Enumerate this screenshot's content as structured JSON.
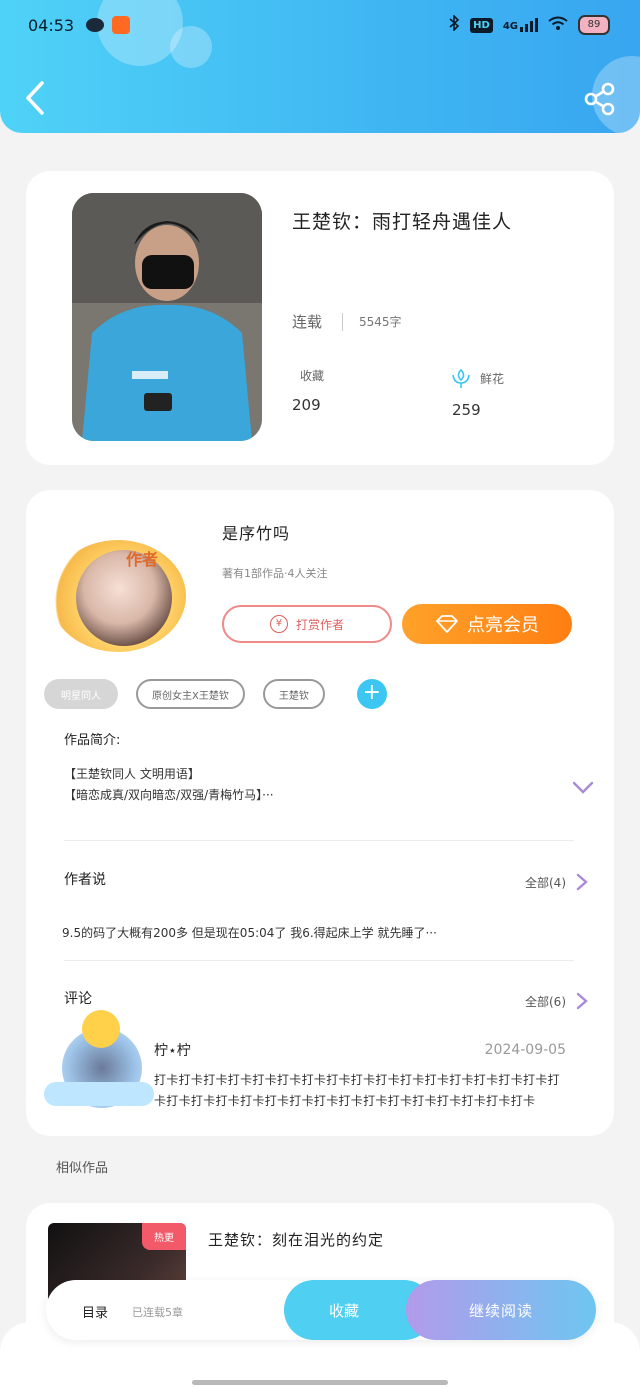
{
  "status_bar": {
    "time": "04:53",
    "network": "4G",
    "hd": "HD",
    "battery": "89"
  },
  "book": {
    "title": "王楚钦：雨打轻舟遇佳人",
    "status": "连载",
    "word_count": "5545字",
    "favorites_label": "收藏",
    "favorites_value": "209",
    "flowers_label": "鲜花",
    "flowers_value": "259"
  },
  "author": {
    "badge": "作者",
    "name": "是序竹吗",
    "meta": "著有1部作品·4人关注",
    "tip_label": "打赏作者",
    "vip_label": "点亮会员"
  },
  "tags": [
    "明星同人",
    "原创女主X王楚钦",
    "王楚钦"
  ],
  "intro": {
    "title": "作品简介:",
    "lines": [
      "【王楚钦同人 文明用语】",
      "【暗恋成真/双向暗恋/双强/青梅竹马】···"
    ]
  },
  "author_says": {
    "title": "作者说",
    "all_label": "全部(4)",
    "text": "9.5的码了大概有200多 但是现在05:04了 我6.得起床上学 就先睡了···"
  },
  "comments": {
    "title": "评论",
    "all_label": "全部(6)",
    "items": [
      {
        "user": "柠⋆柠",
        "date": "2024-09-05",
        "text": "打卡打卡打卡打卡打卡打卡打卡打卡打卡打卡打卡打卡打卡打卡打卡打卡打卡打卡打卡打卡打卡打卡打卡打卡打卡打卡打卡打卡打卡打卡打卡打卡"
      }
    ]
  },
  "similar": {
    "title": "相似作品",
    "items": [
      {
        "badge": "热更",
        "title": "王楚钦：刻在泪光的约定"
      }
    ]
  },
  "bottom_bar": {
    "toc_label": "目录",
    "chapters": "已连载5章",
    "favorite_label": "收藏",
    "read_label": "继续阅读"
  },
  "colors": {
    "header": "#3fb6f2",
    "vip": "#ff8a1a",
    "tip": "#e05e5e",
    "accent": "#3ec6f3"
  },
  "icons": [
    "back-arrow-icon",
    "share-icon",
    "flower-icon",
    "yen-icon",
    "diamond-icon",
    "plus-icon",
    "chevron-down-icon",
    "chevron-right-icon"
  ]
}
